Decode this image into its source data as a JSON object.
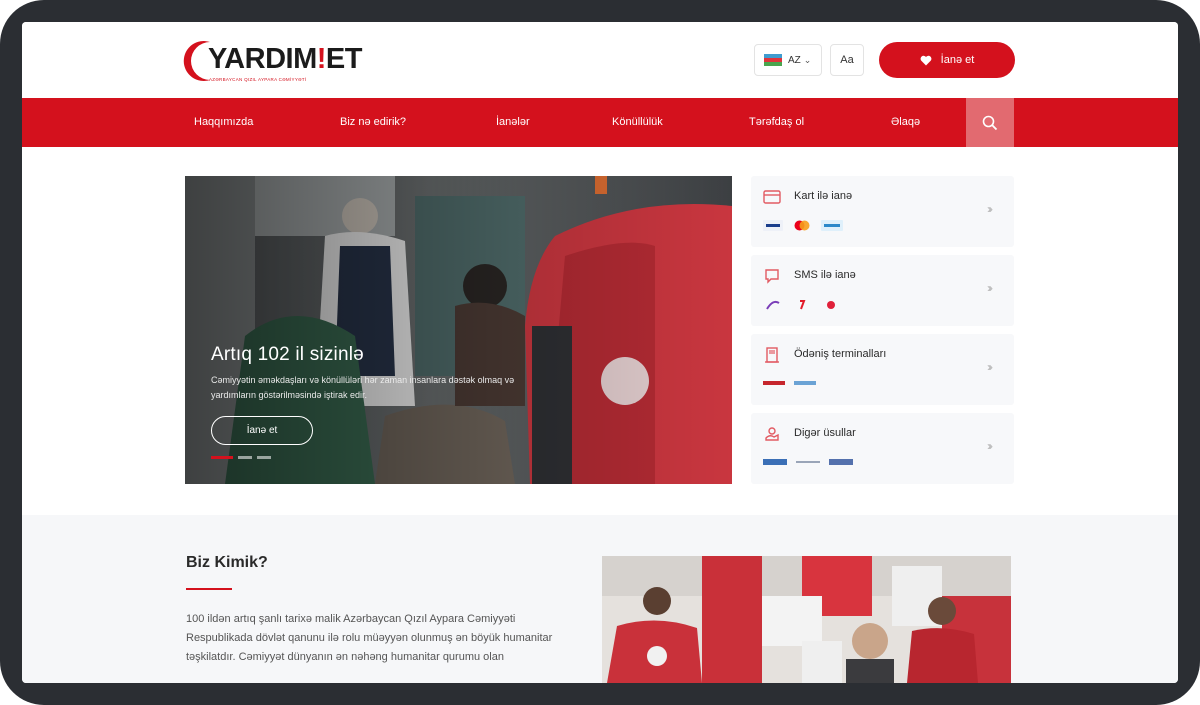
{
  "brand": {
    "logo_text_main": "YARDIM",
    "logo_text_accent": "!",
    "logo_text_end": "ET",
    "logo_subtitle": "AZƏRBAYCAN QIZIL AYPARA CƏMİYYƏTİ"
  },
  "header": {
    "language": "AZ",
    "accessibility_label": "Aa",
    "donate_label": "İanə et"
  },
  "nav": {
    "items": [
      "Haqqımızda",
      "Biz nə edirik?",
      "İanələr",
      "Könüllülük",
      "Tərəfdaş ol",
      "Əlaqə"
    ]
  },
  "hero": {
    "title": "Artıq 102 il sizinlə",
    "text": "Cəmiyyətin əməkdaşları və könüllüləri hər zaman insanlara dəstək olmaq və yardımların göstərilməsində iştirak edir.",
    "button": "İanə et"
  },
  "payment_methods": [
    {
      "title": "Kart ilə ianə",
      "icon": "card-icon"
    },
    {
      "title": "SMS ilə ianə",
      "icon": "sms-icon"
    },
    {
      "title": "Ödəniş terminalları",
      "icon": "terminal-icon"
    },
    {
      "title": "Digər üsullar",
      "icon": "other-methods-icon"
    }
  ],
  "about": {
    "title": "Biz Kimik?",
    "paragraph": "100 ildən artıq şanlı tarixə malik Azərbaycan Qızıl Aypara Cəmiyyəti Respublikada dövlət qanunu ilə rolu müəyyən olunmuş ən böyük humanitar təşkilatdır. Cəmiyyət dünyanın ən nəhəng humanitar qurumu olan"
  },
  "colors": {
    "brand_red": "#d4111d",
    "nav_search_bg": "#e26a70",
    "frame": "#2b2e33",
    "card_bg": "#f7f8fa"
  }
}
